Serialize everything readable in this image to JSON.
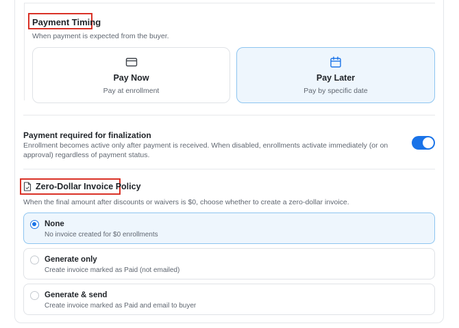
{
  "payment_timing": {
    "title": "Payment Timing",
    "description": "When payment is expected from the buyer.",
    "options": [
      {
        "label": "Pay Now",
        "sublabel": "Pay at enrollment",
        "icon": "credit-card-icon",
        "selected": false
      },
      {
        "label": "Pay Later",
        "sublabel": "Pay by specific date",
        "icon": "calendar-icon",
        "selected": true
      }
    ]
  },
  "payment_required": {
    "title": "Payment required for finalization",
    "description": "Enrollment becomes active only after payment is received. When disabled, enrollments activate immediately (or on approval) regardless of payment status.",
    "enabled": true
  },
  "zero_dollar": {
    "title": "Zero-Dollar Invoice Policy",
    "icon": "document-icon",
    "description": "When the final amount after discounts or waivers is $0, choose whether to create a zero-dollar invoice.",
    "options": [
      {
        "title": "None",
        "sublabel": "No invoice created for $0 enrollments",
        "selected": true
      },
      {
        "title": "Generate only",
        "sublabel": "Create invoice marked as Paid (not emailed)",
        "selected": false
      },
      {
        "title": "Generate & send",
        "sublabel": "Create invoice marked as Paid and email to buyer",
        "selected": false
      }
    ]
  },
  "colors": {
    "accent": "#1a73e8",
    "highlight_box": "#d93025",
    "selected_bg": "#eef6fd"
  }
}
